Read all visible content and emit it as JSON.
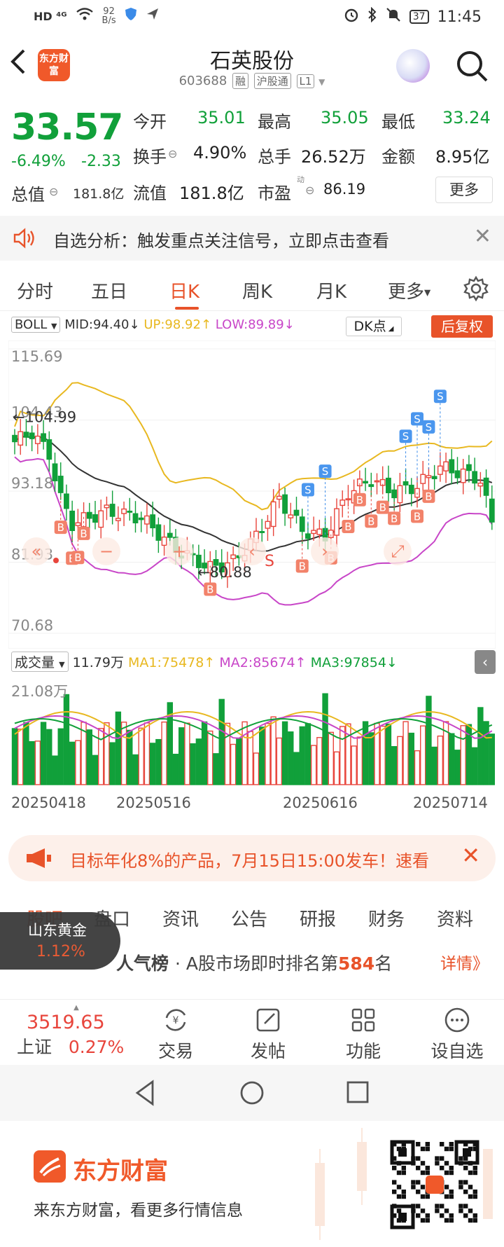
{
  "status_bar": {
    "left_icons": "HD ⁴ᴳ",
    "net_speed": "92",
    "net_unit": "B/s",
    "battery": "37",
    "time": "11:45"
  },
  "header": {
    "logo_text": "东方财富",
    "title": "石英股份",
    "code": "603688",
    "tags": [
      "融",
      "沪股通",
      "L1"
    ]
  },
  "quote": {
    "price": "33.57",
    "change_pct": "-6.49%",
    "change": "-2.33",
    "stats": [
      {
        "label": "今开",
        "value": "35.01"
      },
      {
        "label": "最高",
        "value": "35.05"
      },
      {
        "label": "最低",
        "value": "33.24"
      },
      {
        "label": "换手",
        "value": "4.90%"
      },
      {
        "label": "总手",
        "value": "26.52万"
      },
      {
        "label": "金额",
        "value": "8.95亿"
      },
      {
        "label": "流值",
        "value": "181.8亿"
      },
      {
        "label": "市盈",
        "value": "86.19"
      }
    ],
    "total_label": "总值",
    "total_value": "181.8亿",
    "more": "更多"
  },
  "notice": {
    "text": "自选分析：触发重点关注信号，立即点击查看"
  },
  "tabs": [
    "分时",
    "五日",
    "日K",
    "周K",
    "月K",
    "更多"
  ],
  "boll": {
    "name": "BOLL",
    "mid": "MID:94.40↓",
    "up": "UP:98.92↑",
    "low": "LOW:89.89↓",
    "dk": "DK点",
    "fuquan": "后复权"
  },
  "chart_data": {
    "type": "candlestick",
    "y_ticks": [
      "115.69",
      "104.43",
      "93.18",
      "81.93",
      "70.68"
    ],
    "ylim": [
      70.68,
      115.69
    ],
    "annotations": {
      "high": "104.99",
      "low": "80.88"
    },
    "signals": {
      "buy": "B",
      "sell": "S"
    },
    "colors": {
      "up": "#e8453c",
      "down": "#11a03a",
      "mid": "#333333",
      "upper": "#e8b820",
      "lower": "#c846c8"
    },
    "x_labels": [
      "20250418",
      "20250516",
      "20250616",
      "20250714"
    ]
  },
  "volume": {
    "name": "成交量",
    "value": "11.79万",
    "ma1": "MA1:75478↑",
    "ma2": "MA2:85674↑",
    "ma3": "MA3:97854↓",
    "axis_top": "21.08万"
  },
  "ad": {
    "text": "目标年化8%的产品，7月15日15:00发车！速看"
  },
  "subtabs": [
    "股吧",
    "盘口",
    "资讯",
    "公告",
    "研报",
    "财务",
    "资料"
  ],
  "rank": {
    "pop": "人气榜",
    "text_prefix": "· A股市场即时排名第",
    "rank": "584",
    "text_suffix": "名",
    "detail": "详情》"
  },
  "floating": {
    "name": "山东黄金",
    "pct": "1.12%"
  },
  "bottom_bar": {
    "index_value": "3519.65",
    "index_name": "上证",
    "index_pct": "0.27%",
    "items": [
      "交易",
      "发帖",
      "功能",
      "设自选"
    ]
  },
  "footer": {
    "brand": "东方财富",
    "slogan": "来东方财富，看更多行情信息"
  }
}
